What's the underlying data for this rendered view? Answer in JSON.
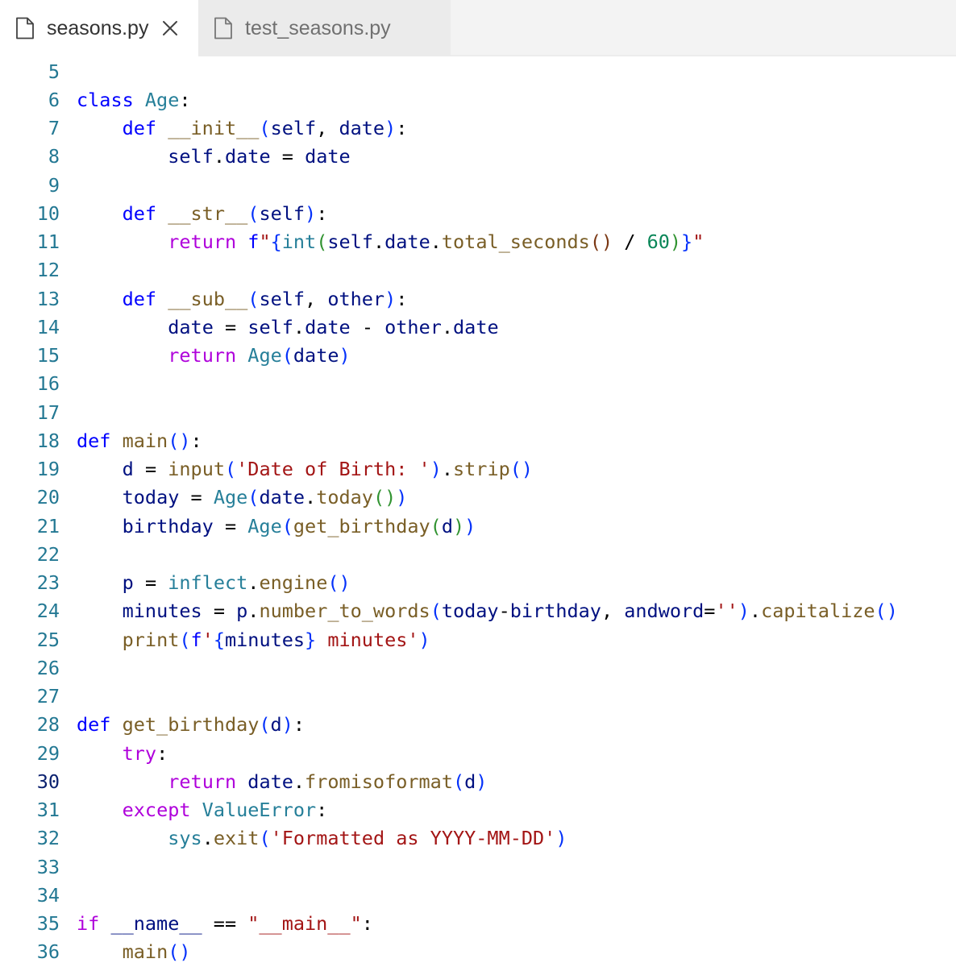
{
  "tabs": [
    {
      "label": "seasons.py",
      "active": true,
      "icon": "file-icon",
      "close_icon": "close-icon"
    },
    {
      "label": "test_seasons.py",
      "active": false,
      "icon": "file-icon"
    }
  ],
  "editor": {
    "current_line": 30,
    "line_numbers": [
      "5",
      "6",
      "7",
      "8",
      "9",
      "10",
      "11",
      "12",
      "13",
      "14",
      "15",
      "16",
      "17",
      "18",
      "19",
      "20",
      "21",
      "22",
      "23",
      "24",
      "25",
      "26",
      "27",
      "28",
      "29",
      "30",
      "31",
      "32",
      "33",
      "34",
      "35",
      "36"
    ],
    "code_lines": [
      "",
      "class Age:",
      "    def __init__(self, date):",
      "        self.date = date",
      "",
      "    def __str__(self):",
      "        return f\"{int(self.date.total_seconds() / 60)}\"",
      "",
      "    def __sub__(self, other):",
      "        date = self.date - other.date",
      "        return Age(date)",
      "",
      "",
      "def main():",
      "    d = input('Date of Birth: ').strip()",
      "    today = Age(date.today())",
      "    birthday = Age(get_birthday(d))",
      "",
      "    p = inflect.engine()",
      "    minutes = p.number_to_words(today-birthday, andword='').capitalize()",
      "    print(f'{minutes} minutes')",
      "",
      "",
      "def get_birthday(d):",
      "    try:",
      "        return date.fromisoformat(d)",
      "    except ValueError:",
      "        sys.exit('Formatted as YYYY-MM-DD')",
      "",
      "",
      "if __name__ == \"__main__\":",
      "    main()"
    ]
  },
  "colors": {
    "keyword": "#0000ff",
    "control": "#af00db",
    "type": "#267f99",
    "function": "#795e26",
    "variable": "#001080",
    "string": "#a31515",
    "number": "#098658",
    "line_number": "#237893"
  }
}
